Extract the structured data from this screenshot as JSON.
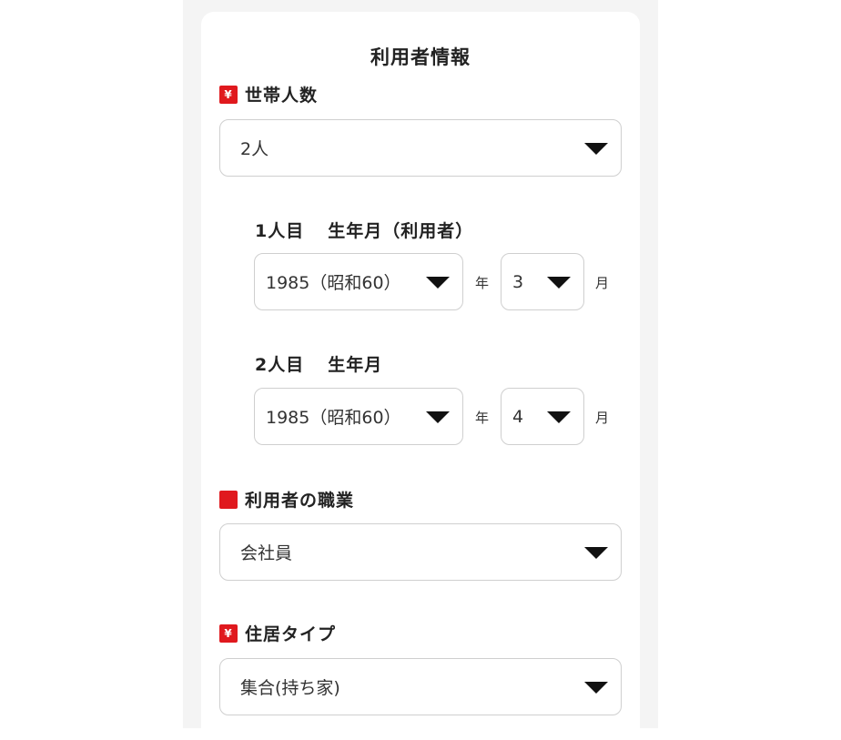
{
  "form": {
    "title": "利用者情報",
    "household": {
      "badge": "¥",
      "label": "世帯人数",
      "value": "2人"
    },
    "members": [
      {
        "label_num": "1人目",
        "label_text": "生年月（利用者）",
        "year": "1985（昭和60）",
        "year_unit": "年",
        "month": "3",
        "month_unit": "月"
      },
      {
        "label_num": "2人目",
        "label_text": "生年月",
        "year": "1985（昭和60）",
        "year_unit": "年",
        "month": "4",
        "month_unit": "月"
      }
    ],
    "occupation": {
      "label": "利用者の職業",
      "value": "会社員"
    },
    "residence": {
      "badge": "¥",
      "label": "住居タイプ",
      "value": "集合(持ち家)"
    }
  },
  "colors": {
    "accent": "#e0191e",
    "border": "#cfcfcf",
    "background": "#f4f4f4"
  },
  "icons": {
    "dropdown": "caret-down-icon"
  }
}
